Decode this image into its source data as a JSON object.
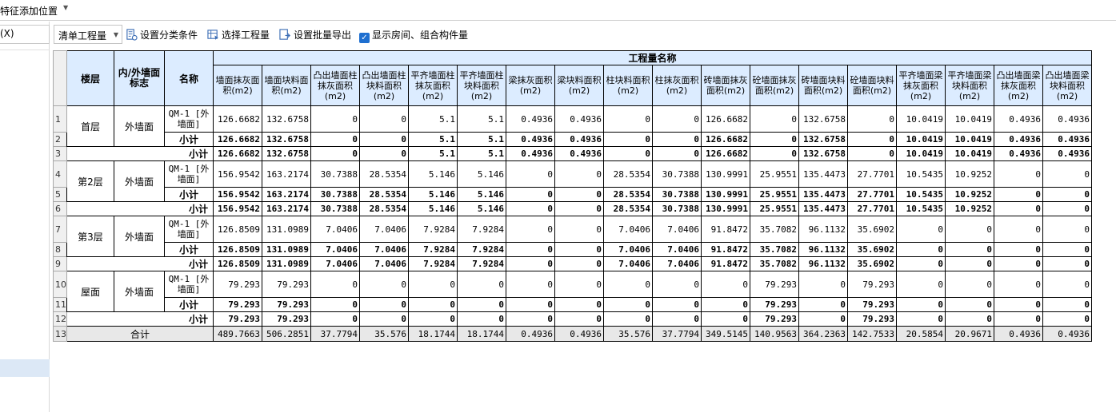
{
  "topbar": {
    "label": "特征添加位置"
  },
  "left": {
    "search_text": "(X)"
  },
  "toolbar": {
    "dropdown_value": "清单工程量",
    "set_category": "设置分类条件",
    "select_quantity": "选择工程量",
    "batch_export": "设置批量导出",
    "show_rooms": "显示房间、组合构件量",
    "show_rooms_checked": true
  },
  "table": {
    "group_header": "工程量名称",
    "headers": {
      "floor": "楼层",
      "side": "内/外墙面标志",
      "name": "名称"
    },
    "columns": [
      "墙面抹灰面积(m2)",
      "墙面块料面积(m2)",
      "凸出墙面柱抹灰面积(m2)",
      "凸出墙面柱块料面积(m2)",
      "平齐墙面柱抹灰面积(m2)",
      "平齐墙面柱块料面积(m2)",
      "梁抹灰面积(m2)",
      "梁块料面积(m2)",
      "柱块料面积(m2)",
      "柱抹灰面积(m2)",
      "砖墙面抹灰面积(m2)",
      "砼墙面抹灰面积(m2)",
      "砖墙面块料面积(m2)",
      "砼墙面块料面积(m2)",
      "平齐墙面梁抹灰面积(m2)",
      "平齐墙面梁块料面积(m2)",
      "凸出墙面梁抹灰面积(m2)",
      "凸出墙面梁块料面积(m2)"
    ],
    "side_label": "外墙面",
    "item_name": "QM-1 [外墙面]",
    "subtotal_label": "小计",
    "total_label": "合计",
    "floors": [
      {
        "name": "首层",
        "rownums": [
          "1",
          "2",
          "3"
        ],
        "values": [
          "126.6682",
          "132.6758",
          "0",
          "0",
          "5.1",
          "5.1",
          "0.4936",
          "0.4936",
          "0",
          "0",
          "126.6682",
          "0",
          "132.6758",
          "0",
          "10.0419",
          "10.0419",
          "0.4936",
          "0.4936"
        ]
      },
      {
        "name": "第2层",
        "rownums": [
          "4",
          "5",
          "6"
        ],
        "values": [
          "156.9542",
          "163.2174",
          "30.7388",
          "28.5354",
          "5.146",
          "5.146",
          "0",
          "0",
          "28.5354",
          "30.7388",
          "130.9991",
          "25.9551",
          "135.4473",
          "27.7701",
          "10.5435",
          "10.9252",
          "0",
          "0"
        ]
      },
      {
        "name": "第3层",
        "rownums": [
          "7",
          "8",
          "9"
        ],
        "values": [
          "126.8509",
          "131.0989",
          "7.0406",
          "7.0406",
          "7.9284",
          "7.9284",
          "0",
          "0",
          "7.0406",
          "7.0406",
          "91.8472",
          "35.7082",
          "96.1132",
          "35.6902",
          "0",
          "0",
          "0",
          "0"
        ]
      },
      {
        "name": "屋面",
        "rownums": [
          "10",
          "11",
          "12"
        ],
        "values": [
          "79.293",
          "79.293",
          "0",
          "0",
          "0",
          "0",
          "0",
          "0",
          "0",
          "0",
          "0",
          "79.293",
          "0",
          "79.293",
          "0",
          "0",
          "0",
          "0"
        ]
      }
    ],
    "total": {
      "rownum": "13",
      "values": [
        "489.7663",
        "506.2851",
        "37.7794",
        "35.576",
        "18.1744",
        "18.1744",
        "0.4936",
        "0.4936",
        "35.576",
        "37.7794",
        "349.5145",
        "140.9563",
        "364.2363",
        "142.7533",
        "20.5854",
        "20.9671",
        "0.4936",
        "0.4936"
      ]
    }
  }
}
